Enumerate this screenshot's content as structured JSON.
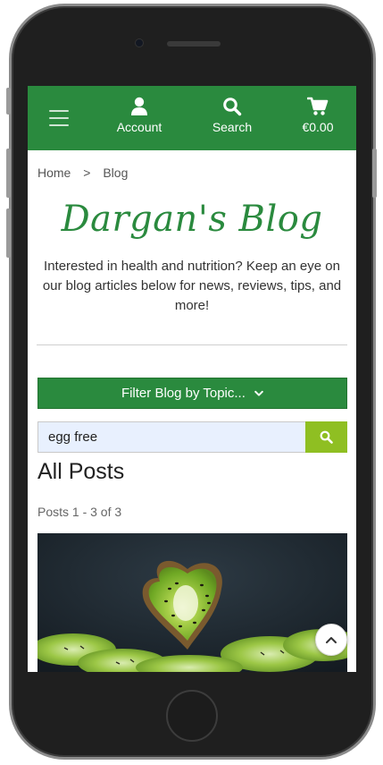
{
  "colors": {
    "brand_green": "#2a8a3e",
    "search_button": "#8fbf22",
    "search_field_bg": "#e8f0fe"
  },
  "nav": {
    "menu_icon": "hamburger-icon",
    "items": [
      {
        "label": "Account",
        "icon": "user-icon"
      },
      {
        "label": "Search",
        "icon": "search-icon"
      },
      {
        "label": "€0.00",
        "icon": "cart-icon"
      }
    ]
  },
  "breadcrumb": {
    "home": "Home",
    "separator": ">",
    "current": "Blog"
  },
  "blog": {
    "title": "Dargan's Blog",
    "intro": "Interested in health and nutrition? Keep an eye on our blog articles below for news, reviews, tips, and more!"
  },
  "filter": {
    "label": "Filter Blog by Topic...",
    "icon": "chevron-down-icon"
  },
  "search": {
    "value": "egg free",
    "icon": "search-icon"
  },
  "posts": {
    "heading": "All Posts",
    "count_text": "Posts 1 - 3 of 3",
    "first_image_alt": "kiwi-image"
  },
  "scroll_top_icon": "chevron-up-icon"
}
